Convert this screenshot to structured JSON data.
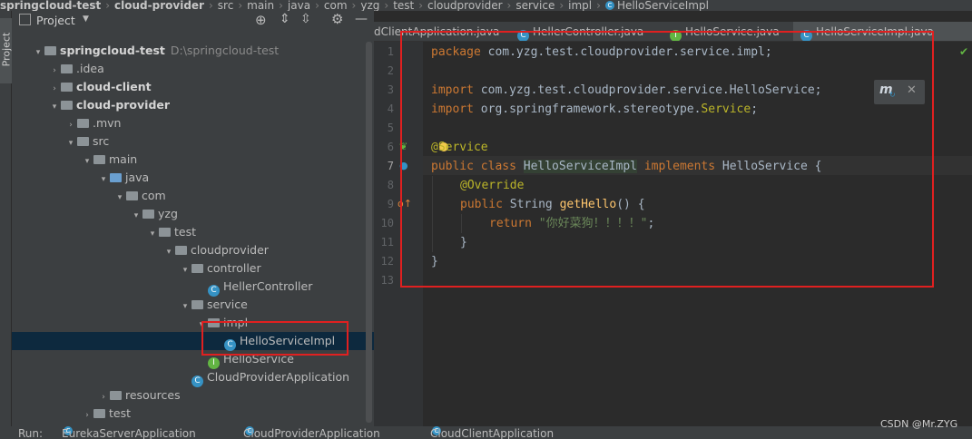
{
  "breadcrumb": [
    "springcloud-test",
    "cloud-provider",
    "src",
    "main",
    "java",
    "com",
    "yzg",
    "test",
    "cloudprovider",
    "service",
    "impl",
    "HelloServiceImpl"
  ],
  "sidebar": {
    "tab_label": "Project"
  },
  "project_panel": {
    "title": "Project",
    "tree": [
      {
        "label": "springcloud-test",
        "path": "D:\\springcloud-test",
        "bold": true,
        "indent": 0,
        "arrow": "▾",
        "icon": "folder"
      },
      {
        "label": ".idea",
        "indent": 1,
        "arrow": "›",
        "icon": "folder"
      },
      {
        "label": "cloud-client",
        "bold": true,
        "indent": 1,
        "arrow": "›",
        "icon": "folder"
      },
      {
        "label": "cloud-provider",
        "bold": true,
        "indent": 1,
        "arrow": "▾",
        "icon": "folder"
      },
      {
        "label": ".mvn",
        "indent": 2,
        "arrow": "›",
        "icon": "folder"
      },
      {
        "label": "src",
        "indent": 2,
        "arrow": "▾",
        "icon": "folder"
      },
      {
        "label": "main",
        "indent": 3,
        "arrow": "▾",
        "icon": "folder"
      },
      {
        "label": "java",
        "indent": 4,
        "arrow": "▾",
        "icon": "folder-blue"
      },
      {
        "label": "com",
        "indent": 5,
        "arrow": "▾",
        "icon": "folder"
      },
      {
        "label": "yzg",
        "indent": 6,
        "arrow": "▾",
        "icon": "folder"
      },
      {
        "label": "test",
        "indent": 7,
        "arrow": "▾",
        "icon": "folder"
      },
      {
        "label": "cloudprovider",
        "indent": 8,
        "arrow": "▾",
        "icon": "folder"
      },
      {
        "label": "controller",
        "indent": 9,
        "arrow": "▾",
        "icon": "folder"
      },
      {
        "label": "HellerController",
        "indent": 10,
        "arrow": "",
        "icon": "class"
      },
      {
        "label": "service",
        "indent": 9,
        "arrow": "▾",
        "icon": "folder"
      },
      {
        "label": "impl",
        "indent": 10,
        "arrow": "▾",
        "icon": "folder"
      },
      {
        "label": "HelloServiceImpl",
        "indent": 11,
        "arrow": "",
        "icon": "class",
        "selected": true
      },
      {
        "label": "HelloService",
        "indent": 10,
        "arrow": "",
        "icon": "interface"
      },
      {
        "label": "CloudProviderApplication",
        "indent": 9,
        "arrow": "",
        "icon": "class-app"
      },
      {
        "label": "resources",
        "indent": 4,
        "arrow": "›",
        "icon": "folder-res"
      },
      {
        "label": "test",
        "indent": 3,
        "arrow": "›",
        "icon": "folder"
      }
    ]
  },
  "tabs": [
    {
      "label": "dClientApplication.java",
      "icon": "class"
    },
    {
      "label": "HellerController.java",
      "icon": "class"
    },
    {
      "label": "HelloService.java",
      "icon": "interface"
    },
    {
      "label": "HelloServiceImpl.java",
      "icon": "class",
      "active": true
    }
  ],
  "editor": {
    "line_numbers": [
      "1",
      "2",
      "3",
      "4",
      "5",
      "6",
      "7",
      "8",
      "9",
      "10",
      "11",
      "12",
      "13"
    ],
    "current_line": "7"
  },
  "code": {
    "l1_kw": "package",
    "l1_rest": " com.yzg.test.cloudprovider.service.impl;",
    "l3_kw": "import",
    "l3_rest": " com.yzg.test.cloudprovider.service.HelloService;",
    "l4_kw": "import",
    "l4_rest": " org.springframework.stereotype.",
    "l4_ann": "Service",
    "l4_end": ";",
    "l6_ann": "@Service",
    "l7_kw1": "public class",
    "l7_cls": "HelloServiceImpl",
    "l7_kw2": "implements",
    "l7_rest": " HelloService {",
    "l8_ann": "@Override",
    "l9_kw": "public",
    "l9_type": " String ",
    "l9_fn": "getHello",
    "l9_rest": "() {",
    "l10_kw": "return",
    "l10_str": "\"你好菜狗！！！！\"",
    "l10_end": ";",
    "l11": "}",
    "l12": "}"
  },
  "bottom_bar": {
    "run_label": "Run:",
    "runs": [
      "EurekaServerApplication",
      "CloudProviderApplication",
      "CloudClientApplication"
    ]
  },
  "watermark": "CSDN @Mr.ZYG",
  "colors": {
    "highlight_red": "#e02020",
    "selection": "#0d293e",
    "keyword": "#cc7832"
  }
}
